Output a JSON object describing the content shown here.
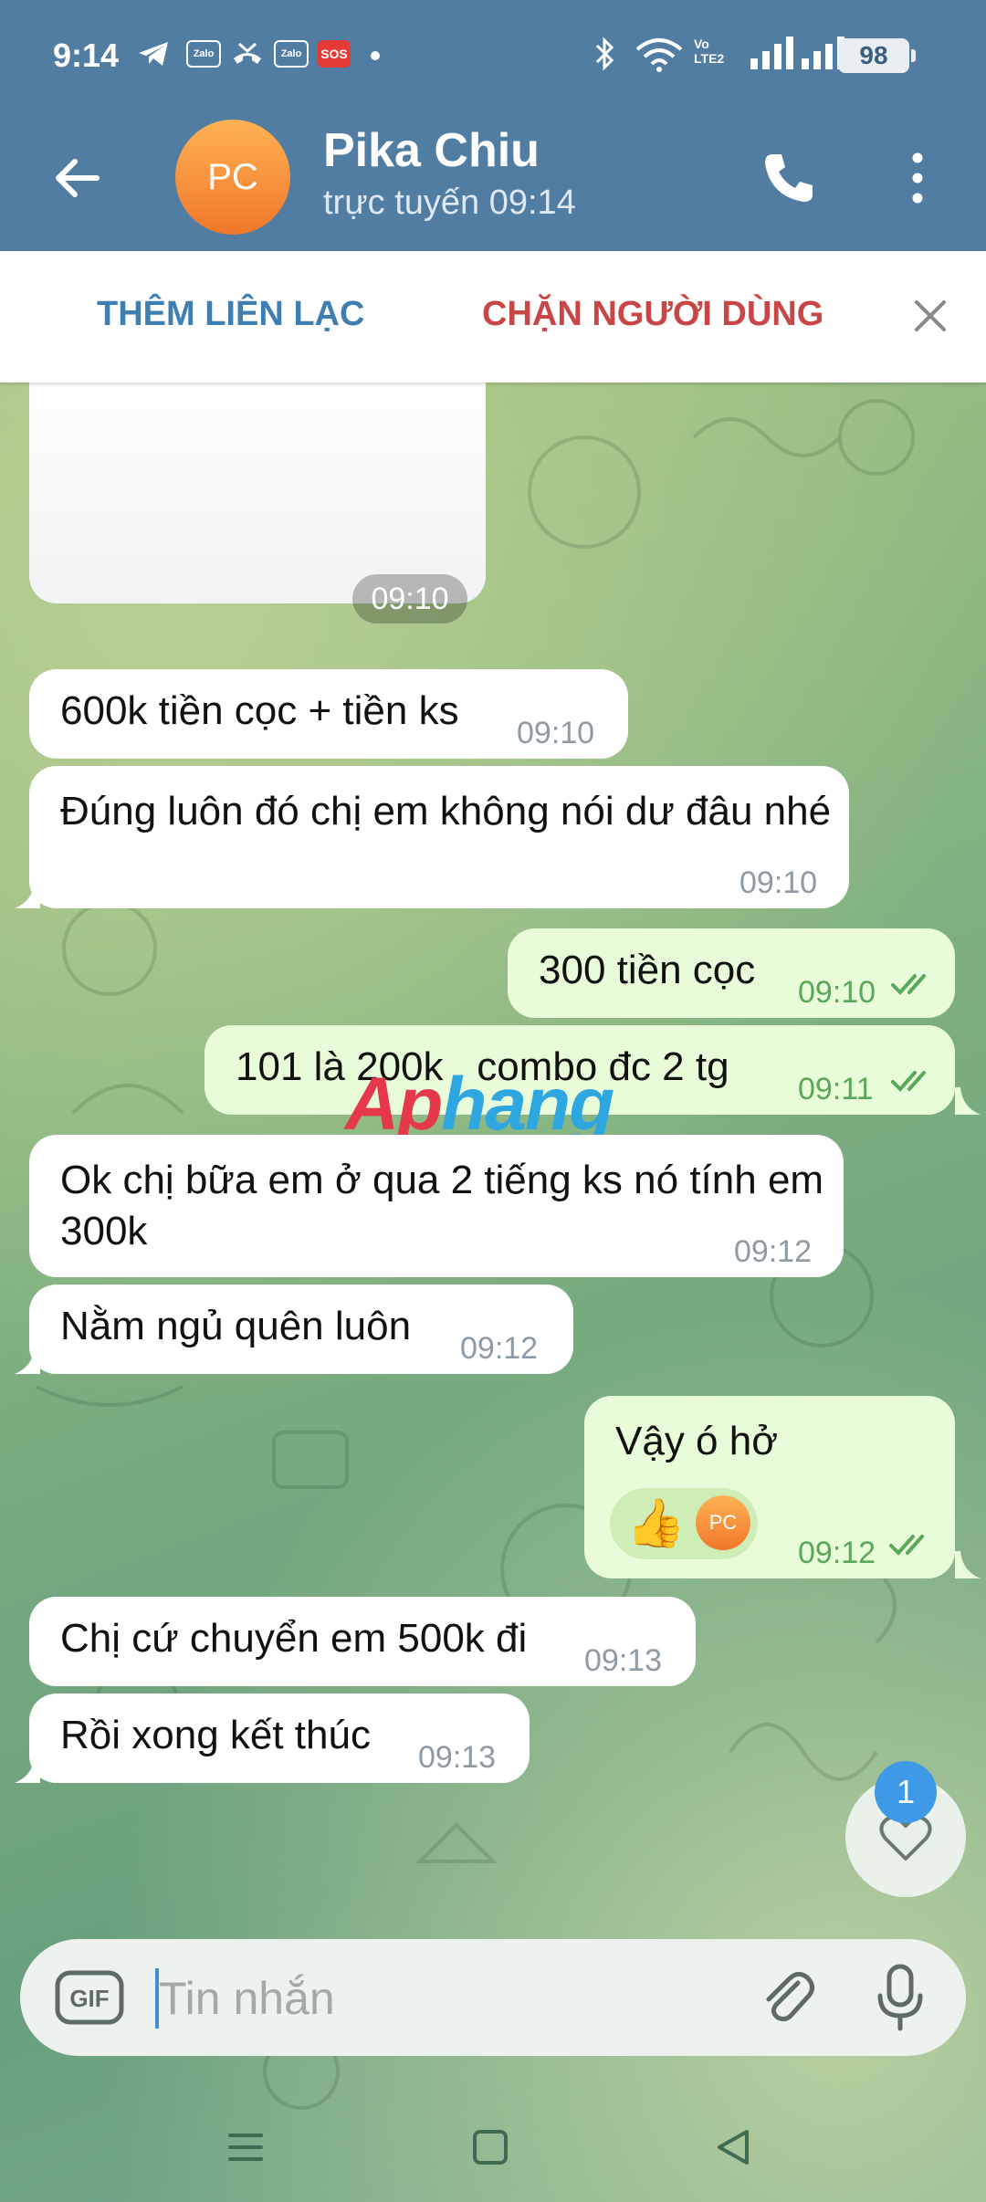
{
  "status_bar": {
    "time": "9:14",
    "battery": "98",
    "network_line1": "Vo",
    "network_line2": "LTE2",
    "zalo_label": "Zalo",
    "sos_label": "SOS"
  },
  "header": {
    "avatar_initials": "PC",
    "contact_name": "Pika Chiu",
    "status": "trực tuyến 09:14"
  },
  "actions": {
    "add_contact": "THÊM LIÊN LẠC",
    "block_user": "CHẶN NGƯỜI DÙNG"
  },
  "image_message": {
    "time": "09:10"
  },
  "messages": [
    {
      "text": "600k tiền cọc + tiền ks",
      "time": "09:10"
    },
    {
      "text": "Đúng luôn đó chị em không nói dư đâu nhé",
      "time": "09:10"
    },
    {
      "text": "300 tiền cọc",
      "time": "09:10"
    },
    {
      "text": "101 là 200k , combo đc 2 tg",
      "time": "09:11"
    },
    {
      "text": "Ok chị bữa em ở qua 2 tiếng ks nó tính em 300k",
      "time": "09:12"
    },
    {
      "text": "Nằm ngủ quên luôn",
      "time": "09:12"
    },
    {
      "text": "Vậy ó hở",
      "time": "09:12"
    },
    {
      "text": "Chị cứ chuyển em 500k đi",
      "time": "09:13"
    },
    {
      "text": "Rồi xong kết thúc",
      "time": "09:13"
    }
  ],
  "reaction": {
    "emoji": "👍",
    "initials": "PC"
  },
  "watermark": {
    "part1": "Ap",
    "part2": "hang"
  },
  "favorite": {
    "badge": "1"
  },
  "composer": {
    "placeholder": "Tin nhắn",
    "gif_label": "GIF"
  },
  "icons": [
    "arrow-back-icon",
    "phone-icon",
    "more-vert-icon",
    "close-icon",
    "double-check-icon",
    "heart-icon",
    "gif-icon",
    "paperclip-icon",
    "microphone-icon",
    "menu-icon",
    "home-square-icon",
    "back-triangle-icon"
  ],
  "colors": {
    "header": "#527da3",
    "outgoing_bubble": "#e9fcd9",
    "incoming_bubble": "#ffffff",
    "check": "#59a85a",
    "add_contact": "#3f7eb1",
    "block_user": "#c94646",
    "avatar": "#f0772a"
  }
}
